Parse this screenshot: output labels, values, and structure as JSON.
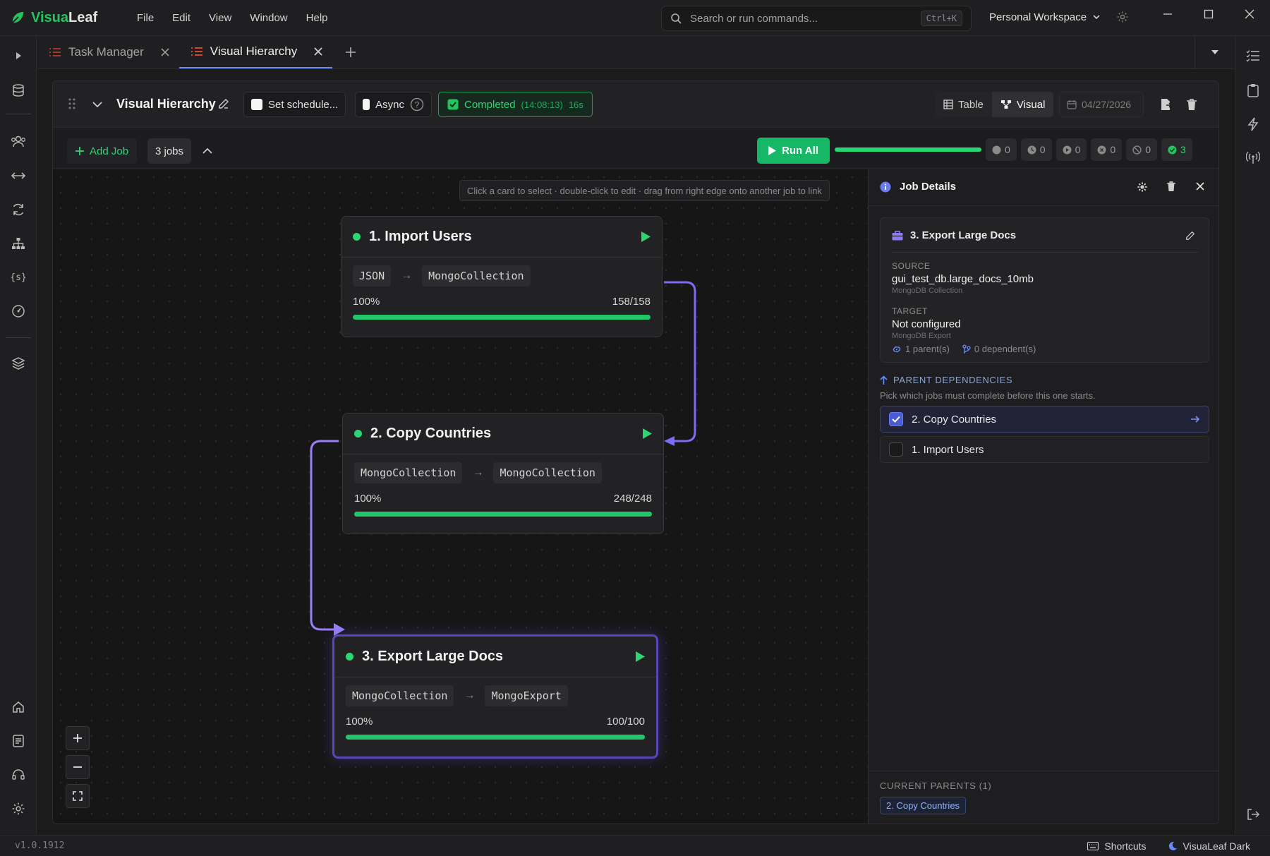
{
  "app": {
    "name_a": "Visua",
    "name_b": "Leaf"
  },
  "menu": [
    "File",
    "Edit",
    "View",
    "Window",
    "Help"
  ],
  "search": {
    "placeholder": "Search or run commands...",
    "shortcut": "Ctrl+K"
  },
  "workspace": "Personal Workspace",
  "tabs": [
    {
      "label": "Task Manager",
      "active": false
    },
    {
      "label": "Visual Hierarchy",
      "active": true
    }
  ],
  "header": {
    "title": "Visual Hierarchy",
    "schedule_label": "Set schedule...",
    "async_label": "Async",
    "status": "Completed",
    "status_time": "(14:08:13)",
    "status_duration": "16s",
    "view_table": "Table",
    "view_visual": "Visual",
    "date": "04/27/2026"
  },
  "toolbar": {
    "add_job": "Add Job",
    "jobs_count": "3 jobs",
    "run_all": "Run All",
    "progress": 1.0,
    "counters": [
      "0",
      "0",
      "0",
      "0",
      "0",
      "3"
    ]
  },
  "canvas": {
    "hint": "Click a card to select · double-click to edit · drag from right edge onto another job to link"
  },
  "jobs": [
    {
      "name": "1. Import Users",
      "source": "JSON",
      "target": "MongoCollection",
      "percent": "100%",
      "count": "158/158",
      "progress": 1.0
    },
    {
      "name": "2. Copy Countries",
      "source": "MongoCollection",
      "target": "MongoCollection",
      "percent": "100%",
      "count": "248/248",
      "progress": 1.0
    },
    {
      "name": "3. Export Large Docs",
      "source": "MongoCollection",
      "target": "MongoExport",
      "percent": "100%",
      "count": "100/100",
      "progress": 1.0
    }
  ],
  "details": {
    "title": "Job Details",
    "job_name": "3. Export Large Docs",
    "source_label": "SOURCE",
    "source_value": "gui_test_db.large_docs_10mb",
    "source_type": "MongoDB Collection",
    "target_label": "TARGET",
    "target_value": "Not configured",
    "target_type": "MongoDB Export",
    "parents": "1 parent(s)",
    "dependents": "0 dependent(s)",
    "parent_deps_title": "PARENT DEPENDENCIES",
    "parent_deps_sub": "Pick which jobs must complete before this one starts.",
    "deps": [
      {
        "name": "2. Copy Countries",
        "checked": true
      },
      {
        "name": "1. Import Users",
        "checked": false
      }
    ],
    "current_parents_label": "CURRENT PARENTS (1)",
    "current_parents": [
      "2. Copy Countries"
    ]
  },
  "statusbar": {
    "version": "v1.0.1912",
    "shortcuts": "Shortcuts",
    "theme": "VisuaLeaf Dark"
  },
  "colors": {
    "accent_green": "#22c55e",
    "link_purple": "#8b6cf5",
    "link_blue": "#6b7cf0"
  }
}
